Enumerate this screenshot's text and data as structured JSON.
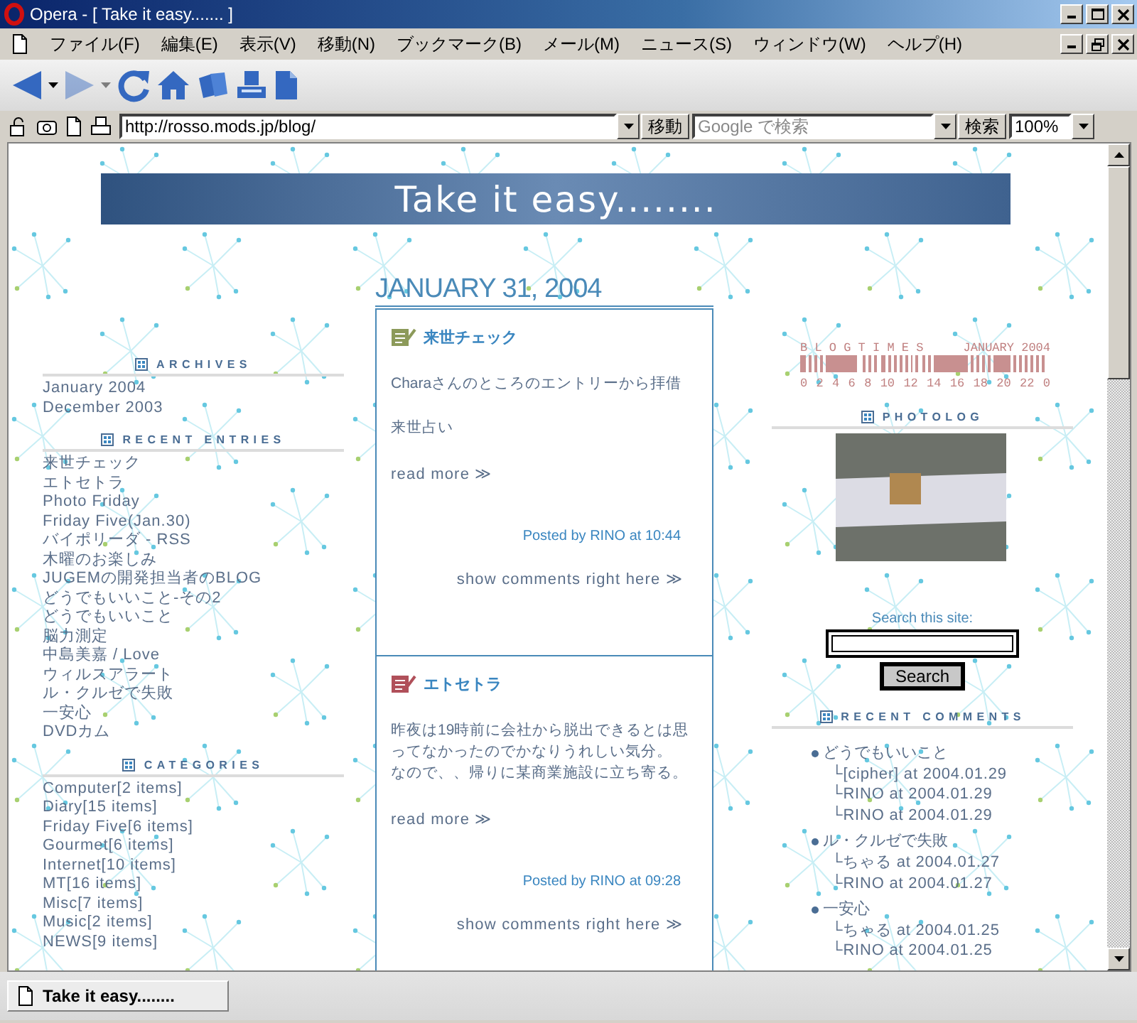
{
  "window": {
    "title": "Opera - [ Take it easy....... ]"
  },
  "menu": [
    "ファイル(F)",
    "編集(E)",
    "表示(V)",
    "移動(N)",
    "ブックマーク(B)",
    "メール(M)",
    "ニュース(S)",
    "ウィンドウ(W)",
    "ヘルプ(H)"
  ],
  "toolbar": [
    {
      "kind": "back",
      "disabled": false
    },
    {
      "kind": "forward",
      "disabled": true
    },
    {
      "kind": "reload",
      "disabled": false
    },
    {
      "kind": "home",
      "disabled": false
    },
    {
      "kind": "hotlist",
      "disabled": false
    },
    {
      "kind": "print",
      "disabled": false
    },
    {
      "kind": "page",
      "disabled": false
    }
  ],
  "address_bar": {
    "url": "http://rosso.mods.jp/blog/",
    "go_button": "移動",
    "search_placeholder": "Google で検索",
    "search_button": "検索",
    "zoom": "100%"
  },
  "page": {
    "banner_title": "Take it easy........",
    "left_sidebar": [
      {
        "heading": "ARCHIVES",
        "items": [
          "January 2004",
          "December 2003"
        ]
      },
      {
        "heading": "RECENT ENTRIES",
        "items": [
          "来世チェック",
          "エトセトラ",
          "Photo Friday",
          "Friday Five(Jan.30)",
          "バイポリーダ - RSS",
          "木曜のお楽しみ",
          "JUGEMの開発担当者のBLOG",
          "どうでもいいこと-その2",
          "どうでもいいこと",
          "脳力測定",
          "中島美嘉 / Love",
          "ウィルスアラート",
          "ル・クルゼで失敗",
          "一安心",
          "DVDカム"
        ]
      },
      {
        "heading": "CATEGORIES",
        "items": [
          "Computer[2 items]",
          "Diary[15 items]",
          "Friday Five[6 items]",
          "Gourmet[6 items]",
          "Internet[10 items]",
          "MT[16 items]",
          "Misc[7 items]",
          "Music[2 items]",
          "NEWS[9 items]"
        ]
      }
    ],
    "date_heading": "JANUARY 31, 2004",
    "posts": [
      {
        "title": "来世チェック",
        "color": "#8c9a5a",
        "paragraphs": [
          [
            "Charaさんのところのエントリーから拝借"
          ],
          [
            "来世占い"
          ]
        ],
        "read_more": "read more ≫",
        "posted": "Posted by RINO at 10:44",
        "comments_link": "show comments right here ≫"
      },
      {
        "title": "エトセトラ",
        "color": "#b0505a",
        "paragraphs": [
          [
            "昨夜は19時前に会社から脱出できるとは思ってなかったのでかなりうれしい気分。",
            "なので、、帰りに某商業施設に立ち寄る。"
          ]
        ],
        "read_more": "read more ≫",
        "posted": "Posted by RINO at 09:28",
        "comments_link": "show comments right here ≫"
      }
    ],
    "blogtimes": {
      "title": "B L O G T I M E S",
      "month": "JANUARY 2004",
      "hours": [
        "0",
        "2",
        "4",
        "6",
        "8",
        "10",
        "12",
        "14",
        "16",
        "18",
        "20",
        "22",
        "0"
      ]
    },
    "photolog_heading": "PHOTOLOG",
    "search": {
      "label": "Search this site:",
      "button": "Search"
    },
    "recent_comments": {
      "heading": "RECENT COMMENTS",
      "entries": [
        {
          "title": "どうでもいいこと",
          "comments": [
            "└[cipher] at 2004.01.29",
            "└RINO at 2004.01.29",
            "└RINO at 2004.01.29"
          ]
        },
        {
          "title": "ル・クルゼで失敗",
          "comments": [
            "└ちゃる at 2004.01.27",
            "└RINO at 2004.01.27"
          ]
        },
        {
          "title": "一安心",
          "comments": [
            "└ちゃる at 2004.01.25",
            "└RINO at 2004.01.25"
          ]
        }
      ]
    }
  },
  "status_bar": {
    "tab_title": "Take it easy........"
  }
}
